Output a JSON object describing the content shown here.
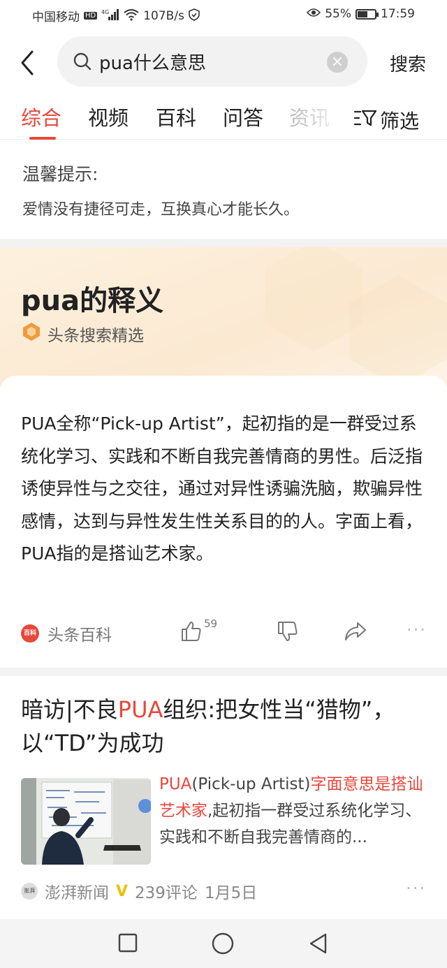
{
  "status_bar": {
    "carrier": "中国移动",
    "hd": "HD",
    "network": "4G",
    "speed": "107B/s",
    "battery_pct": "55%",
    "battery_level": 0.55,
    "time": "17:59"
  },
  "search": {
    "query": "pua什么意思",
    "submit_label": "搜索"
  },
  "tabs": [
    {
      "label": "综合",
      "active": true
    },
    {
      "label": "视频"
    },
    {
      "label": "百科"
    },
    {
      "label": "问答"
    },
    {
      "label": "资讯"
    }
  ],
  "filter_label": "筛选",
  "tip": {
    "title": "温馨提示:",
    "text": "爱情没有捷径可走，互换真心才能长久。"
  },
  "definition": {
    "title": "pua的释义",
    "source": "头条搜索精选",
    "body": "PUA全称“Pick-up Artist”，起初指的是一群受过系统化学习、实践和不断自我完善情商的男性。后泛指诱使异性与之交往，通过对异性诱骗洗脑，欺骗异性感情，达到与异性发生性关系目的的人。字面上看，PUA指的是搭讪艺术家。",
    "footer_source": "头条百科",
    "footer_badge": "百科",
    "likes": "59"
  },
  "article": {
    "title_part1": "暗访|不良",
    "title_highlight": "PUA",
    "title_part2": "组织:把女性当“猎物”，以“TD”为成功",
    "summary_hl1": "PUA",
    "summary_part1": "(Pick-up Artist)",
    "summary_hl2": "字面意思是搭讪艺术家",
    "summary_part2": ",起初指一群受过系统化学习、实践和不断自我完善情商的...",
    "source": "澎湃新闻",
    "source_badge": "澎湃",
    "verified": "V",
    "comments": "239评论",
    "date": "1月5日"
  },
  "colors": {
    "accent": "#e8473b",
    "verified": "#e8c200"
  }
}
